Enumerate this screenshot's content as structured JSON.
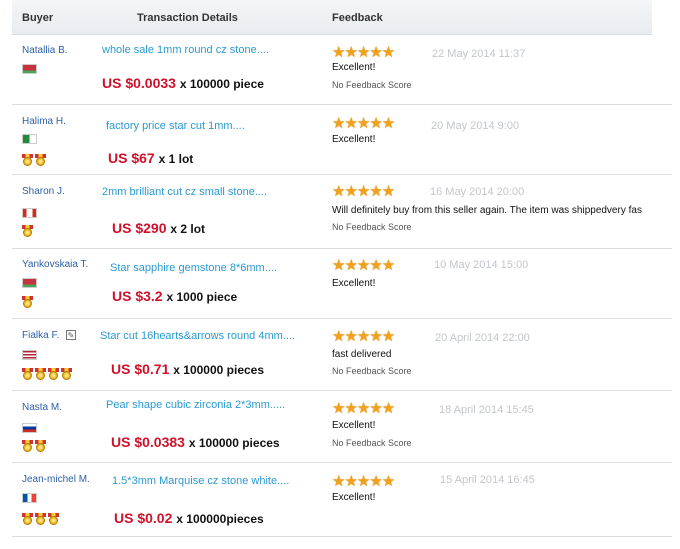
{
  "headers": {
    "buyer": "Buyer",
    "details": "Transaction Details",
    "feedback": "Feedback"
  },
  "rows": [
    {
      "buyer": "Natallia B.",
      "product": "whole sale 1mm round cz stone....",
      "price": "US $0.0033",
      "qty": "x 100000 piece",
      "rating": 5,
      "comment": "Excellent!",
      "no_score": "No Feedback Score",
      "date": "22 May 2014 11:37",
      "flag": "belarus",
      "medals": 0
    },
    {
      "buyer": "Halima H.",
      "product": "factory price star cut 1mm....",
      "price": "US $67",
      "qty": "x 1 lot",
      "rating": 5,
      "comment": "Excellent!",
      "no_score": "",
      "date": "20 May 2014 9:00",
      "flag": "algeria",
      "medals": 2
    },
    {
      "buyer": "Sharon J.",
      "product": "2mm brilliant cut cz small stone....",
      "price": "US $290",
      "qty": "x 2 lot",
      "rating": 5,
      "comment": "Will definitely buy from this seller again. The item was shippedvery fas",
      "no_score": "No Feedback Score",
      "date": "16 May 2014 20:00",
      "flag": "canada",
      "medals": 1
    },
    {
      "buyer": "Yankovskaia T.",
      "product": "Star sapphire gemstone 8*6mm....",
      "price": "US $3.2",
      "qty": "x 1000 piece",
      "rating": 5,
      "comment": "Excellent!",
      "no_score": "",
      "date": "10 May 2014 15:00",
      "flag": "belarus",
      "medals": 1
    },
    {
      "buyer": "Fialka F.",
      "product": "Star cut 16hearts&arrows round 4mm....",
      "price": "US $0.71",
      "qty": "x 100000 pieces",
      "rating": 5,
      "comment": "fast delivered",
      "no_score": "No Feedback Score",
      "date": "20 April 2014 22:00",
      "flag": "usa",
      "medals": 4
    },
    {
      "buyer": "Nasta M.",
      "product": "Pear shape cubic zirconia 2*3mm.....",
      "price": "US $0.0383",
      "qty": "x 100000 pieces",
      "rating": 5,
      "comment": "Excellent!",
      "no_score": "No Feedback Score",
      "date": "18 April 2014 15:45",
      "flag": "russia",
      "medals": 2
    },
    {
      "buyer": "Jean-michel M.",
      "product": "1.5*3mm Marquise cz stone white....",
      "price": "US $0.02",
      "qty": "x 100000pieces",
      "rating": 5,
      "comment": "Excellent!",
      "no_score": "",
      "date": "15 April 2014 16:45",
      "flag": "france",
      "medals": 3
    }
  ],
  "colors": {
    "price": "#d0112b",
    "product": "#2a9ad1",
    "buyer": "#2d5fa6",
    "star": "#f2a11a"
  }
}
